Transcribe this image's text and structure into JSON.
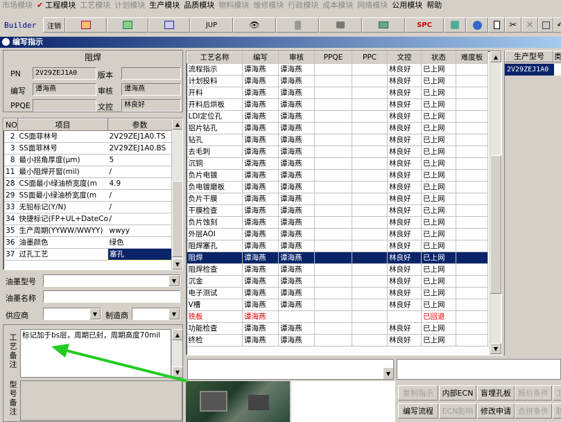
{
  "menu": [
    {
      "label": "市场模块",
      "active": false,
      "checked": false
    },
    {
      "label": "工程模块",
      "active": true,
      "checked": true
    },
    {
      "label": "工艺模块",
      "active": false,
      "checked": false
    },
    {
      "label": "计划模块",
      "active": false,
      "checked": false
    },
    {
      "label": "生产模块",
      "active": true,
      "checked": false
    },
    {
      "label": "品质模块",
      "active": true,
      "checked": false
    },
    {
      "label": "物料模块",
      "active": false,
      "checked": false
    },
    {
      "label": "维修模块",
      "active": false,
      "checked": false
    },
    {
      "label": "行政模块",
      "active": false,
      "checked": false
    },
    {
      "label": "成本模块",
      "active": false,
      "checked": false
    },
    {
      "label": "网络模块",
      "active": false,
      "checked": false
    },
    {
      "label": "公用模块",
      "active": true,
      "checked": false
    },
    {
      "label": "帮助",
      "active": true,
      "checked": false
    }
  ],
  "toolbar": {
    "builder": "Builder",
    "logout": "注销",
    "jup": "JUP",
    "spc": "SPC"
  },
  "window_title": "编写指示",
  "left": {
    "section_title": "阻焊",
    "pn_label": "PN",
    "pn_value": "2V29ZEJ1A0",
    "version_label": "版本",
    "version_value": "",
    "author_label": "编写",
    "author_value": "谭海燕",
    "review_label": "审核",
    "review_value": "谭海燕",
    "ppqe_label": "PPQE",
    "ppqe_value": "",
    "docctrl_label": "文控",
    "docctrl_value": "林良好",
    "param_headers": {
      "no": "NO",
      "item": "项目",
      "param": "参数"
    },
    "params": [
      {
        "no": "2",
        "item": "CS面菲林号",
        "param": "2V29ZEJ1A0.TS"
      },
      {
        "no": "3",
        "item": "SS面菲林号",
        "param": "2V29ZEJ1A0.BS"
      },
      {
        "no": "8",
        "item": "最小拐角厚度(μm)",
        "param": "5"
      },
      {
        "no": "11",
        "item": "最小阻焊开窗(mil)",
        "param": "/"
      },
      {
        "no": "28",
        "item": "CS面最小绿油桥宽度(m",
        "param": "4.9"
      },
      {
        "no": "29",
        "item": "SS面最小绿油桥宽度(m",
        "param": "/"
      },
      {
        "no": "33",
        "item": "无铅标记(Y/N)",
        "param": "/"
      },
      {
        "no": "34",
        "item": "快捷标记(FP+UL+DateCo",
        "param": "/"
      },
      {
        "no": "35",
        "item": "生产周期(YYWW/WWYY)",
        "param": "wwyy"
      },
      {
        "no": "36",
        "item": "油墨颜色",
        "param": "绿色"
      },
      {
        "no": "37",
        "item": "过孔工艺",
        "param": "塞孔"
      }
    ],
    "ink_model_label": "油墨型号",
    "ink_name_label": "油墨名称",
    "supplier_label": "供应商",
    "maker_label": "制造商",
    "process_note_label": "工艺备注",
    "process_note": "标记加于bs层，周期已封，周期高度70mil",
    "model_note_label": "型号备注"
  },
  "main_headers": [
    "工艺名称",
    "编写",
    "审核",
    "PPQE",
    "PPC",
    "文控",
    "状态",
    "难度板"
  ],
  "main_rows": [
    [
      "流程指示",
      "谭海燕",
      "谭海燕",
      "",
      "",
      "林良好",
      "已上网",
      ""
    ],
    [
      "计划投料",
      "谭海燕",
      "谭海燕",
      "",
      "",
      "林良好",
      "已上网",
      ""
    ],
    [
      "开料",
      "谭海燕",
      "谭海燕",
      "",
      "",
      "林良好",
      "已上网",
      ""
    ],
    [
      "开料后烘板",
      "谭海燕",
      "谭海燕",
      "",
      "",
      "林良好",
      "已上网",
      ""
    ],
    [
      "LDI定位孔",
      "谭海燕",
      "谭海燕",
      "",
      "",
      "林良好",
      "已上网",
      ""
    ],
    [
      "铝片钻孔",
      "谭海燕",
      "谭海燕",
      "",
      "",
      "林良好",
      "已上网",
      ""
    ],
    [
      "钻孔",
      "谭海燕",
      "谭海燕",
      "",
      "",
      "林良好",
      "已上网",
      ""
    ],
    [
      "去毛刺",
      "谭海燕",
      "谭海燕",
      "",
      "",
      "林良好",
      "已上网",
      ""
    ],
    [
      "沉铜",
      "谭海燕",
      "谭海燕",
      "",
      "",
      "林良好",
      "已上网",
      ""
    ],
    [
      "负片电镀",
      "谭海燕",
      "谭海燕",
      "",
      "",
      "林良好",
      "已上网",
      ""
    ],
    [
      "负电镀磨板",
      "谭海燕",
      "谭海燕",
      "",
      "",
      "林良好",
      "已上网",
      ""
    ],
    [
      "负片干膜",
      "谭海燕",
      "谭海燕",
      "",
      "",
      "林良好",
      "已上网",
      ""
    ],
    [
      "干膜检查",
      "谭海燕",
      "谭海燕",
      "",
      "",
      "林良好",
      "已上网",
      ""
    ],
    [
      "负片蚀刻",
      "谭海燕",
      "谭海燕",
      "",
      "",
      "林良好",
      "已上网",
      ""
    ],
    [
      "外层AOI",
      "谭海燕",
      "谭海燕",
      "",
      "",
      "林良好",
      "已上网",
      ""
    ],
    [
      "阻焊塞孔",
      "谭海燕",
      "谭海燕",
      "",
      "",
      "林良好",
      "已上网",
      ""
    ],
    [
      "阻焊",
      "谭海燕",
      "谭海燕",
      "",
      "",
      "林良好",
      "已上网",
      ""
    ],
    [
      "阻焊检查",
      "谭海燕",
      "谭海燕",
      "",
      "",
      "林良好",
      "已上网",
      ""
    ],
    [
      "沉金",
      "谭海燕",
      "谭海燕",
      "",
      "",
      "林良好",
      "已上网",
      ""
    ],
    [
      "电子测试",
      "谭海燕",
      "谭海燕",
      "",
      "",
      "林良好",
      "已上网",
      ""
    ],
    [
      "V槽",
      "谭海燕",
      "谭海燕",
      "",
      "",
      "林良好",
      "已上网",
      ""
    ],
    [
      "铣板",
      "谭海燕",
      "",
      "",
      "",
      "",
      "已回退",
      ""
    ],
    [
      "功能检查",
      "谭海燕",
      "谭海燕",
      "",
      "",
      "林良好",
      "已上网",
      ""
    ],
    [
      "终检",
      "谭海燕",
      "谭海燕",
      "",
      "",
      "林良好",
      "已上网",
      ""
    ]
  ],
  "selected_row": 16,
  "red_row": 21,
  "right": {
    "header": "生产型号",
    "header2": "类",
    "value": "2V29ZEJ1A0"
  },
  "buttons": {
    "row1": [
      "复制指示",
      "内部ECN",
      "盲埋孔板",
      "报价条件",
      "工"
    ],
    "row2": [
      "编写流程",
      "ECN影响",
      "修改申请",
      "合拼条件",
      "取"
    ]
  },
  "colors": {
    "selection": "#0a246a",
    "reverted": "#e00000",
    "arrow": "#22cc22"
  }
}
